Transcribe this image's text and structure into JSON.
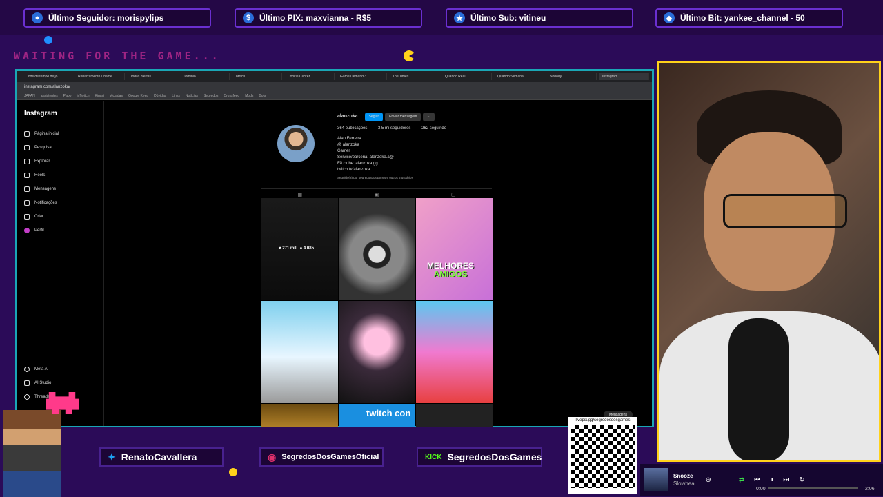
{
  "alerts": [
    {
      "label": "Último Seguidor: morispylips",
      "icon": "user-icon",
      "color": "#2a6dd8"
    },
    {
      "label": "Último PIX: maxvianna - R$5",
      "icon": "dollar-icon",
      "color": "#2a6dd8"
    },
    {
      "label": "Último Sub: vitineu",
      "icon": "star-icon",
      "color": "#2a6dd8"
    },
    {
      "label": "Último Bit: yankee_channel - 50",
      "icon": "diamond-icon",
      "color": "#2a6dd8"
    }
  ],
  "waiting": "WAITING FOR THE GAME...",
  "browser": {
    "tabs": [
      "Odds de tempo de jo",
      "Rebaixamento Chame",
      "Todas ofertas",
      "Domínio",
      "Twitch",
      "Cookie Clicker",
      "Game Demand 3",
      "The Times",
      "Quando Real",
      "Quando Semanal",
      "Nobody",
      "Instagram"
    ],
    "url": "instagram.com/alanzoka/",
    "bookmarks": [
      "JAPAN",
      "assistentes",
      "Papo",
      "inTwitch",
      "Kingsi",
      "Viciadas",
      "Google Keep",
      "Dúvidas",
      "Links",
      "Notícias",
      "Segredos",
      "Crossfeed",
      "Mods",
      "Bots"
    ]
  },
  "instagram": {
    "logo": "Instagram",
    "nav": [
      "Página inicial",
      "Pesquisa",
      "Explorar",
      "Reels",
      "Mensagens",
      "Notificações",
      "Criar",
      "Perfil"
    ],
    "nav_bottom": [
      "Meta AI",
      "AI Studio",
      "Threads"
    ],
    "username": "alanzoka",
    "follow_label": "Seguir",
    "message_label": "Enviar mensagem",
    "stats": [
      "364 publicações",
      "3,5 mi seguidores",
      "262 seguindo"
    ],
    "name": "Alan Ferreira",
    "handle": "@ alanzoka",
    "bio": [
      "Gamer",
      "Serviço/parceria: alanzoka.a@",
      "Fã clube: alanzoka.gg",
      "twitch.tv/alanzoka"
    ],
    "followed_by": "Seguido(a) por segredosdosgames e outros 5 usuários",
    "post_overlay_likes": "271 mil",
    "post_overlay_comments": "4.085",
    "banner_line1": "MELHORES",
    "banner_line2": "AMIGOS",
    "twitchcon": "twitch con",
    "messages_label": "Mensagens"
  },
  "socials": [
    {
      "label": "RenatoCavallera",
      "icon": "twitter-icon"
    },
    {
      "label": "SegredosDosGamesOficial",
      "icon": "instagram-icon"
    },
    {
      "label": "SegredosDosGames",
      "icon": "kick-icon"
    }
  ],
  "qr_label": "livepix.gg/segredosdosgames",
  "player": {
    "title": "Snooze",
    "artist": "Slowheal",
    "time_current": "0:00",
    "time_total": "2:06",
    "progress": 0
  }
}
